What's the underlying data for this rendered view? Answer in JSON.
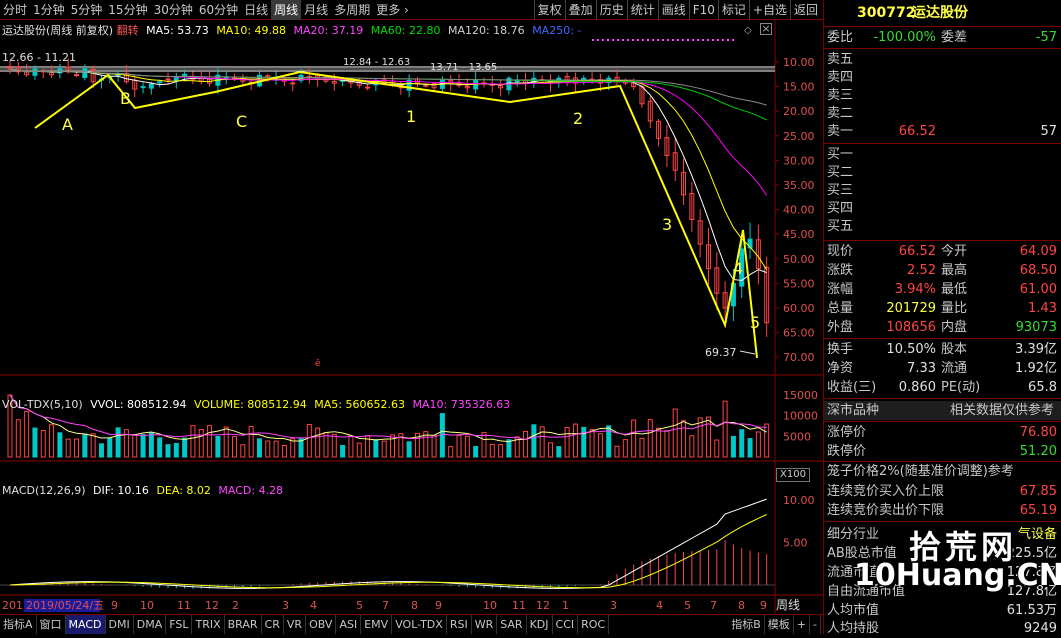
{
  "toolbar": {
    "left": [
      "分时",
      "1分钟",
      "5分钟",
      "15分钟",
      "30分钟",
      "60分钟",
      "日线",
      "周线",
      "月线",
      "多周期",
      "更多 ›"
    ],
    "active": "周线",
    "right": [
      "复权",
      "叠加",
      "历史",
      "统计",
      "画线",
      "F10",
      "标记",
      "+自选",
      "返回"
    ]
  },
  "main": {
    "title": "运达股份(周线 前复权)",
    "indicator": "翻转",
    "ma5": "MA5: 53.73",
    "ma10": "MA10: 49.88",
    "ma20": "MA20: 37.19",
    "ma60": "MA60: 22.80",
    "ma120": "MA120: 18.76",
    "ma250": "MA250: -",
    "high_label": "12.66 - 11.21",
    "zone1": "12.84 - 12.63",
    "zone2": "13.71 - 13.65",
    "low_label": "69.37",
    "wave_labels": [
      "A",
      "B",
      "C",
      "1",
      "2",
      "3",
      "4",
      "5"
    ],
    "y_ticks": [
      "10.00",
      "15.00",
      "20.00",
      "25.00",
      "30.00",
      "35.00",
      "40.00",
      "45.00",
      "50.00",
      "55.00",
      "60.00",
      "65.00",
      "70.00"
    ]
  },
  "volume": {
    "title": "VOL-TDX(5,10)",
    "vvol": "VVOL: 808512.94",
    "volume": "VOLUME: 808512.94",
    "ma5": "MA5: 560652.63",
    "ma10": "MA10: 735326.63",
    "y_ticks": [
      "15000",
      "10000",
      "5000"
    ],
    "unit": "X100"
  },
  "macd": {
    "title": "MACD(12,26,9)",
    "dif": "DIF: 10.16",
    "dea": "DEA: 8.02",
    "macd": "MACD: 4.28",
    "y_ticks": [
      "10.00",
      "5.00"
    ]
  },
  "xaxis": {
    "labels": [
      "201",
      "2019/05/24/五",
      "9",
      "10",
      "11",
      "12",
      "2",
      "3",
      "4",
      "5",
      "7",
      "8",
      "9",
      "10",
      "11",
      "12",
      "1",
      "3",
      "4",
      "5",
      "7",
      "8",
      "9",
      "10"
    ],
    "period": "周线"
  },
  "bottombar": {
    "tabs": [
      "指标A",
      "窗口",
      "MACD",
      "DMI",
      "DMA",
      "FSL",
      "TRIX",
      "BRAR",
      "CR",
      "VR",
      "OBV",
      "ASI",
      "EMV",
      "VOL-TDX",
      "RSI",
      "WR",
      "SAR",
      "KDJ",
      "CCI",
      "ROC"
    ],
    "active": "MACD",
    "right": [
      "指标B",
      "模板",
      "+",
      "-"
    ]
  },
  "quote": {
    "code": "300772",
    "name": "运达股份",
    "weibi_label": "委比",
    "weibi": "-100.00%",
    "weicha_label": "委差",
    "weicha": "-57",
    "sell": [
      {
        "label": "卖五",
        "price": "",
        "vol": ""
      },
      {
        "label": "卖四",
        "price": "",
        "vol": ""
      },
      {
        "label": "卖三",
        "price": "",
        "vol": ""
      },
      {
        "label": "卖二",
        "price": "",
        "vol": ""
      },
      {
        "label": "卖一",
        "price": "66.52",
        "vol": "57"
      }
    ],
    "buy": [
      {
        "label": "买一",
        "price": "",
        "vol": ""
      },
      {
        "label": "买二",
        "price": "",
        "vol": ""
      },
      {
        "label": "买三",
        "price": "",
        "vol": ""
      },
      {
        "label": "买四",
        "price": "",
        "vol": ""
      },
      {
        "label": "买五",
        "price": "",
        "vol": ""
      }
    ],
    "stats": [
      {
        "l1": "现价",
        "v1": "66.52",
        "c1": "red",
        "l2": "今开",
        "v2": "64.09",
        "c2": "red"
      },
      {
        "l1": "涨跌",
        "v1": "2.52",
        "c1": "red",
        "l2": "最高",
        "v2": "68.50",
        "c2": "red"
      },
      {
        "l1": "涨幅",
        "v1": "3.94%",
        "c1": "red",
        "l2": "最低",
        "v2": "61.00",
        "c2": "red"
      },
      {
        "l1": "总量",
        "v1": "201729",
        "c1": "yel",
        "l2": "量比",
        "v2": "1.43",
        "c2": "red"
      },
      {
        "l1": "外盘",
        "v1": "108656",
        "c1": "red",
        "l2": "内盘",
        "v2": "93073",
        "c2": "grn"
      }
    ],
    "stats2": [
      {
        "l1": "换手",
        "v1": "10.50%",
        "c1": "wht",
        "l2": "股本",
        "v2": "3.39亿",
        "c2": "wht"
      },
      {
        "l1": "净资",
        "v1": "7.33",
        "c1": "wht",
        "l2": "流通",
        "v2": "1.92亿",
        "c2": "wht"
      },
      {
        "l1": "收益(三)",
        "v1": "0.860",
        "c1": "wht",
        "l2": "PE(动)",
        "v2": "65.8",
        "c2": "wht"
      }
    ],
    "market_label": "深市品种",
    "market_note": "相关数据仅供参考",
    "limit_up_label": "涨停价",
    "limit_up": "76.80",
    "limit_down_label": "跌停价",
    "limit_down": "51.20",
    "cage_label": "笼子价格2%(随基准价调整)参考",
    "cage_up_label": "连续竞价买入价上限",
    "cage_up": "67.85",
    "cage_down_label": "连续竞价卖出价下限",
    "cage_down": "65.19",
    "industry_label": "细分行业",
    "industry": "气设备",
    "ab_label": "AB股总市值",
    "ab": "225.5亿",
    "float_label": "流通市值",
    "float": "127.8亿",
    "free_label": "自由流通市值",
    "free": "127.8亿",
    "percap_label": "人均市值",
    "percap": "61.53万",
    "perhold_label": "人均持股",
    "perhold": "9249"
  },
  "watermark": {
    "line1": "拾荒网",
    "line2": "10Huang.CN"
  },
  "colors": {
    "up": "#ff4545",
    "down": "#00c8c8",
    "ma5": "#ffffff",
    "ma10": "#ffff00",
    "ma20": "#ff00ff",
    "ma60": "#00cc00",
    "ma120": "#888888",
    "wave": "#ffff00"
  }
}
